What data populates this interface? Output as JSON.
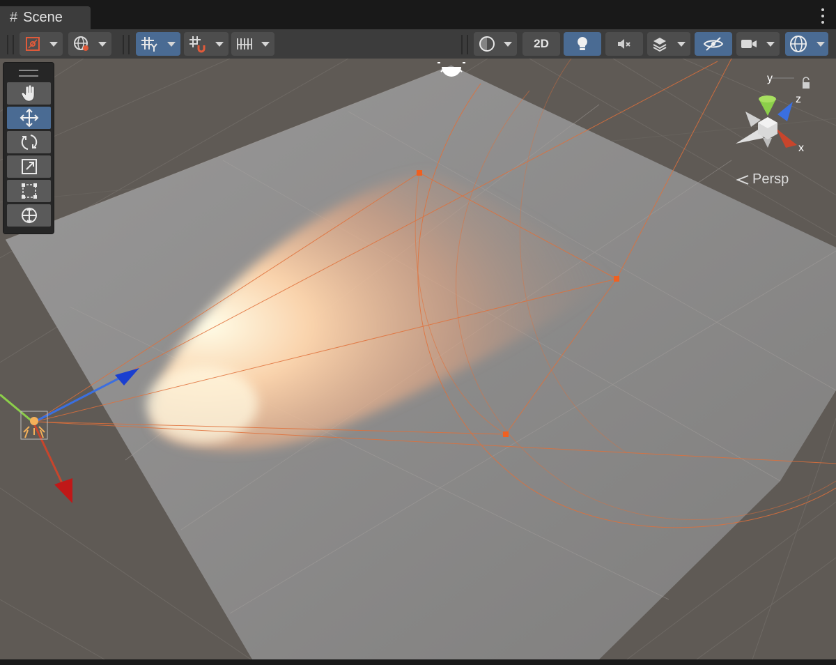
{
  "window": {
    "tab_title": "Scene",
    "tab_icon": "hash-grid-icon"
  },
  "toolbar": {
    "left_group": [
      {
        "name": "draw-mode-button",
        "icon": "draw-mode-icon",
        "has_dropdown": true
      },
      {
        "name": "global-local-button",
        "icon": "globe-icon",
        "has_dropdown": true
      }
    ],
    "grid_group": [
      {
        "name": "grid-visibility-button",
        "icon": "grid-y-icon",
        "active": true,
        "has_dropdown": true
      },
      {
        "name": "grid-snapping-button",
        "icon": "grid-snap-icon",
        "has_dropdown": true
      },
      {
        "name": "increment-snap-button",
        "icon": "ruler-icon",
        "has_dropdown": true
      }
    ],
    "right_group": [
      {
        "name": "shading-mode-button",
        "icon": "sphere-shading-icon",
        "has_dropdown": true
      },
      {
        "name": "2d-toggle",
        "label": "2D"
      },
      {
        "name": "lighting-toggle",
        "icon": "lightbulb-icon",
        "active": true
      },
      {
        "name": "audio-toggle",
        "icon": "speaker-mute-icon"
      },
      {
        "name": "effects-button",
        "icon": "layers-icon",
        "has_dropdown": true
      },
      {
        "name": "hidden-objects-toggle",
        "icon": "eye-off-icon",
        "active": true
      },
      {
        "name": "camera-button",
        "icon": "video-camera-icon",
        "has_dropdown": true
      },
      {
        "name": "gizmos-button",
        "icon": "gizmo-sphere-icon",
        "active": true,
        "has_dropdown": true
      }
    ],
    "twod_label": "2D"
  },
  "tools": [
    {
      "name": "hand-tool",
      "icon": "hand-icon",
      "active": false
    },
    {
      "name": "move-tool",
      "icon": "move-arrows-icon",
      "active": true
    },
    {
      "name": "rotate-tool",
      "icon": "rotate-icon",
      "active": false
    },
    {
      "name": "scale-tool",
      "icon": "scale-icon",
      "active": false
    },
    {
      "name": "rect-tool",
      "icon": "rect-transform-icon",
      "active": false
    },
    {
      "name": "transform-tool",
      "icon": "transform-icon",
      "active": false
    }
  ],
  "gizmo": {
    "x_label": "x",
    "y_label": "y",
    "z_label": "z",
    "projection_label": "Persp",
    "x_color": "#c8452c",
    "y_color": "#8ccf4a",
    "z_color": "#3a6fe0"
  },
  "scene": {
    "plane_color": "#8a8989",
    "background_color": "#5f5a55",
    "light_color": "#ffd9b0",
    "light_range_color": "#e0703a",
    "selected_light": "spot-light"
  }
}
